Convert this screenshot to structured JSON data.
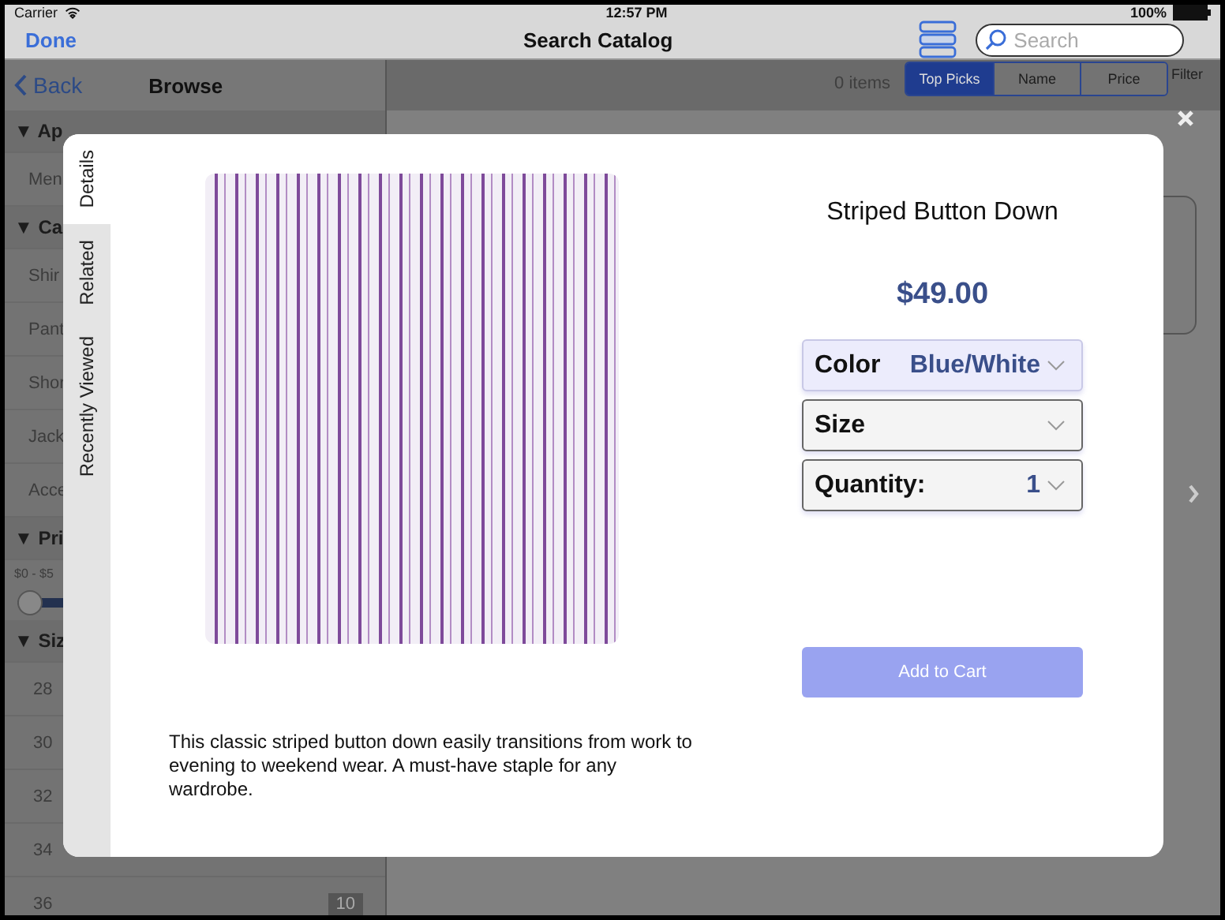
{
  "status_bar": {
    "carrier": "Carrier",
    "time": "12:57 PM",
    "battery": "100%"
  },
  "nav_bar": {
    "done": "Done",
    "title": "Search Catalog",
    "search": {
      "placeholder": "Search"
    }
  },
  "sidebar": {
    "back": "Back",
    "title": "Browse",
    "items": [
      {
        "kind": "header",
        "marker": "▼",
        "label": "Ap"
      },
      {
        "kind": "item",
        "label": "Men"
      },
      {
        "kind": "header",
        "marker": "▼",
        "label": "Ca"
      },
      {
        "kind": "item",
        "label": "Shir"
      },
      {
        "kind": "item",
        "label": "Pant"
      },
      {
        "kind": "item",
        "label": "Shor"
      },
      {
        "kind": "item",
        "label": "Jack"
      },
      {
        "kind": "item",
        "label": "Acce"
      },
      {
        "kind": "header",
        "marker": "▼",
        "label": "Pri"
      },
      {
        "kind": "range",
        "label": "$0 - $5"
      },
      {
        "kind": "slider",
        "level": 0
      },
      {
        "kind": "header",
        "marker": "▼",
        "label": "Siz"
      },
      {
        "kind": "size",
        "label": "28"
      },
      {
        "kind": "size",
        "label": "30"
      },
      {
        "kind": "size",
        "label": "32"
      },
      {
        "kind": "size",
        "label": "34"
      },
      {
        "kind": "size",
        "label": "36",
        "count": "10"
      }
    ]
  },
  "toolbar": {
    "count": "0 items",
    "sort_tabs": [
      {
        "label": "Top Picks",
        "selected": true
      },
      {
        "label": "Name",
        "selected": false
      },
      {
        "label": "Price",
        "selected": false
      }
    ],
    "filter": "Filter"
  },
  "modal": {
    "tabs": [
      {
        "label": "Details",
        "selected": true
      },
      {
        "label": "Related",
        "selected": false
      },
      {
        "label": "Recently Viewed",
        "selected": false
      }
    ],
    "title": "Striped Button Down",
    "price": "$49.00",
    "options": [
      {
        "label": "Color",
        "value": "Blue/White",
        "selected": true
      },
      {
        "label": "Size",
        "selected": false
      },
      {
        "label": "Quantity:",
        "value": "1",
        "selected": false
      }
    ],
    "add_to_cart": {
      "label": "Add to Cart",
      "disabled": true
    },
    "description": "This classic striped button down easily transitions from work to evening to weekend wear.  A must-have staple for any wardrobe."
  }
}
